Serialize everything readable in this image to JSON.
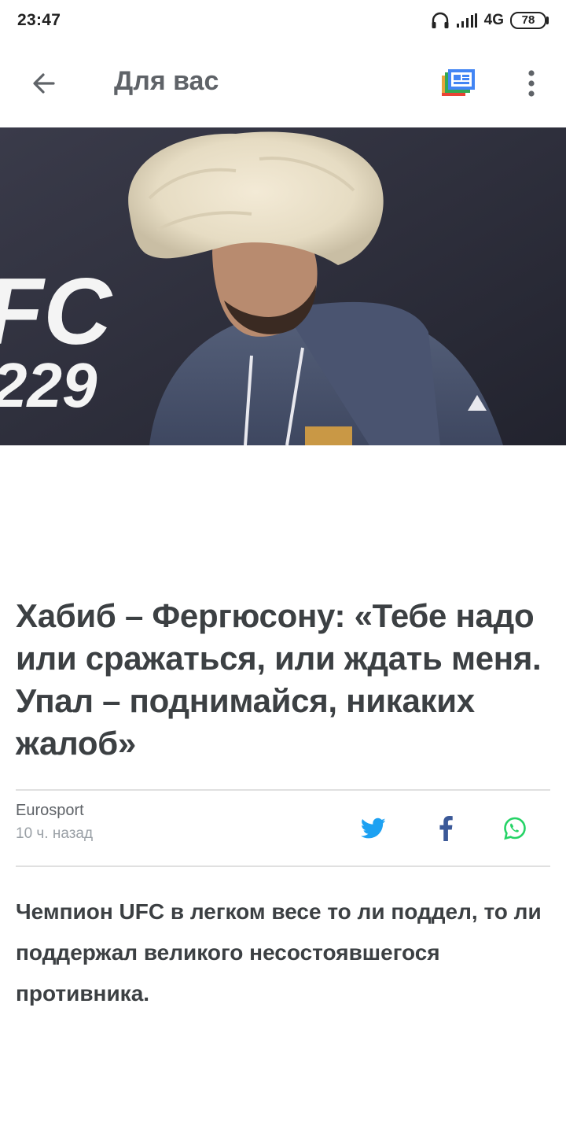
{
  "status_bar": {
    "time": "23:47",
    "network": "4G",
    "battery": "78",
    "icons": [
      "headphone-icon",
      "signal-icon",
      "battery-icon"
    ]
  },
  "app_bar": {
    "title": "Для вас",
    "icons": [
      "back-arrow-icon",
      "newsstand-icon",
      "more-vert-icon"
    ]
  },
  "hero": {
    "overlay_text_line1": "FC",
    "overlay_text_line2": "229"
  },
  "article": {
    "headline": "Хабиб – Фергюсону: «Тебе надо или сражаться, или ждать меня. Упал – поднимайся, никаких жалоб»",
    "source": "Eurosport",
    "timestamp": "10 ч. назад",
    "lede": "Чемпион UFC в легком весе то ли поддел, то ли поддержал великого несостоявшегося противника."
  },
  "share": {
    "icons": [
      "twitter-icon",
      "facebook-icon",
      "whatsapp-icon"
    ]
  },
  "colors": {
    "twitter": "#1da1f2",
    "facebook": "#3b5998",
    "whatsapp": "#25d366",
    "text": "#3c4043",
    "muted": "#5f6368",
    "hint": "#9aa0a6"
  }
}
